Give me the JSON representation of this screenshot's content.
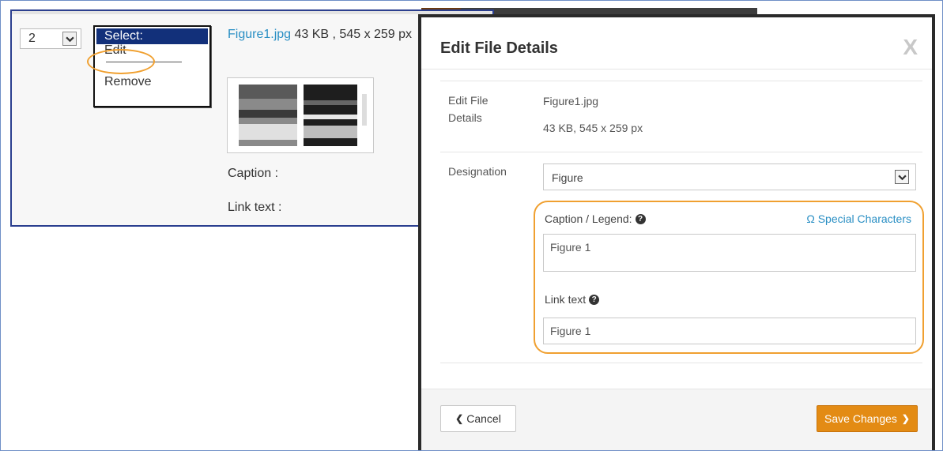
{
  "row": {
    "order_value": "2",
    "action_menu": {
      "options": [
        "Select:",
        "Edit",
        "Remove"
      ]
    },
    "file": {
      "name": "Figure1.jpg",
      "meta": "43 KB , 545 x 259 px"
    },
    "caption_label": "Caption :",
    "link_text_label": "Link text :"
  },
  "modal": {
    "title": "Edit File Details",
    "close_label": "X",
    "details_label": "Edit File Details",
    "file_name": "Figure1.jpg",
    "file_meta": "43 KB, 545 x 259 px",
    "designation_label": "Designation",
    "designation_value": "Figure",
    "caption_label": "Caption / Legend:",
    "special_characters": "Ω Special Characters",
    "caption_value": "Figure 1",
    "link_text_label": "Link text",
    "link_text_value": "Figure 1",
    "cancel_label": "Cancel",
    "save_label": "Save Changes"
  },
  "colors": {
    "accent_orange": "#e38b14",
    "highlight_ring": "#f0a030",
    "link_blue": "#2a8fc4",
    "select_highlight": "#12307a"
  },
  "icons": {
    "help": "question-circle-icon",
    "chevron_down": "chevron-down-icon",
    "chevron_left": "chevron-left-icon",
    "chevron_right": "chevron-right-icon"
  }
}
